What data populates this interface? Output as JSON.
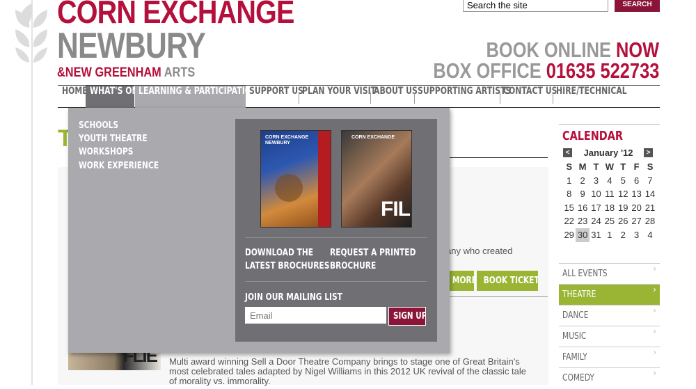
{
  "brand": {
    "line1": "CORN EXCHANGE",
    "line2": "NEWBURY",
    "line3_amp": "&",
    "line3_red": "NEW GREENHAM",
    "line3_grey": " ARTS"
  },
  "search": {
    "placeholder": "Search the site",
    "value": "Search the site",
    "button": "SEARCH"
  },
  "booking": {
    "book_grey": "BOOK ONLINE ",
    "book_red": "NOW",
    "box_grey": "BOX OFFICE ",
    "box_red": "01635 522733"
  },
  "nav": [
    "HOME",
    "WHAT'S ON",
    "LEARNING & PARTICIPATION",
    "SUPPORT US",
    "PLAN YOUR VISIT",
    "ABOUT US",
    "SUPPORTING ARTISTS",
    "CONTACT US",
    "HIRE/TECHNICAL"
  ],
  "dropdown": {
    "links": [
      "SCHOOLS",
      "YOUTH THEATRE",
      "WORKSHOPS",
      "WORK EXPERIENCE"
    ],
    "brochure_a": "CORN EXCHANGE NEWBURY",
    "brochure_b": "CORN EXCHANGE",
    "brochure_b_big": "FILM",
    "download_1": "DOWNLOAD THE",
    "download_2": "LATEST BROCHURES",
    "request_1": "REQUEST A PRINTED",
    "request_2": "BROCHURE",
    "mailing_title": "JOIN OUR MAILING LIST",
    "email_placeholder": "Email",
    "signup": "SIGN UP"
  },
  "main": {
    "heading_fragment": "T",
    "text_fragment": "mpany who created",
    "more": "MORE",
    "book": "BOOK TICKETS",
    "thumb_text": "FLIE",
    "description": "Multi award winning Sell a Door Theatre Company brings to stage one of Great Britain's most celebrated tales adapted by Nigel Williams in this 2012 UK revival of the classic tale of morality vs. immorality."
  },
  "calendar": {
    "title": "CALENDAR",
    "month": "January '12",
    "prev": "<",
    "next": ">",
    "headers": [
      "S",
      "M",
      "T",
      "W",
      "T",
      "F",
      "S"
    ],
    "weeks": [
      [
        "1",
        "2",
        "3",
        "4",
        "5",
        "6",
        "7"
      ],
      [
        "8",
        "9",
        "10",
        "11",
        "12",
        "13",
        "14"
      ],
      [
        "15",
        "16",
        "17",
        "18",
        "19",
        "20",
        "21"
      ],
      [
        "22",
        "23",
        "24",
        "25",
        "26",
        "27",
        "28"
      ],
      [
        "29",
        "30",
        "31",
        "1",
        "2",
        "3",
        "4"
      ]
    ],
    "today": "30"
  },
  "categories": [
    "ALL EVENTS",
    "THEATRE",
    "DANCE",
    "MUSIC",
    "FAMILY",
    "COMEDY"
  ],
  "active_category": "THEATRE",
  "colors": {
    "brand_red": "#b5103c",
    "dark_red": "#8a1538",
    "green": "#9ab534",
    "menu_grey": "#a9a9ae",
    "menu_dark": "#6f6f74"
  }
}
